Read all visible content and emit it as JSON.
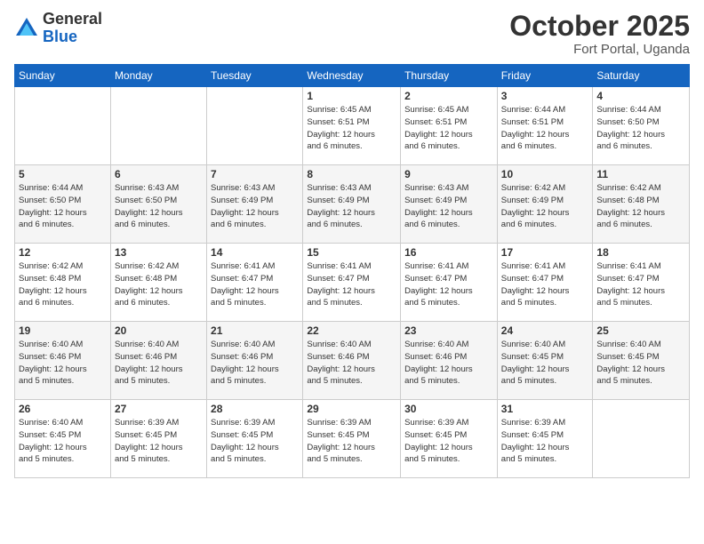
{
  "header": {
    "logo_general": "General",
    "logo_blue": "Blue",
    "month_title": "October 2025",
    "location": "Fort Portal, Uganda"
  },
  "weekdays": [
    "Sunday",
    "Monday",
    "Tuesday",
    "Wednesday",
    "Thursday",
    "Friday",
    "Saturday"
  ],
  "weeks": [
    [
      {
        "day": "",
        "info": ""
      },
      {
        "day": "",
        "info": ""
      },
      {
        "day": "",
        "info": ""
      },
      {
        "day": "1",
        "info": "Sunrise: 6:45 AM\nSunset: 6:51 PM\nDaylight: 12 hours\nand 6 minutes."
      },
      {
        "day": "2",
        "info": "Sunrise: 6:45 AM\nSunset: 6:51 PM\nDaylight: 12 hours\nand 6 minutes."
      },
      {
        "day": "3",
        "info": "Sunrise: 6:44 AM\nSunset: 6:51 PM\nDaylight: 12 hours\nand 6 minutes."
      },
      {
        "day": "4",
        "info": "Sunrise: 6:44 AM\nSunset: 6:50 PM\nDaylight: 12 hours\nand 6 minutes."
      }
    ],
    [
      {
        "day": "5",
        "info": "Sunrise: 6:44 AM\nSunset: 6:50 PM\nDaylight: 12 hours\nand 6 minutes."
      },
      {
        "day": "6",
        "info": "Sunrise: 6:43 AM\nSunset: 6:50 PM\nDaylight: 12 hours\nand 6 minutes."
      },
      {
        "day": "7",
        "info": "Sunrise: 6:43 AM\nSunset: 6:49 PM\nDaylight: 12 hours\nand 6 minutes."
      },
      {
        "day": "8",
        "info": "Sunrise: 6:43 AM\nSunset: 6:49 PM\nDaylight: 12 hours\nand 6 minutes."
      },
      {
        "day": "9",
        "info": "Sunrise: 6:43 AM\nSunset: 6:49 PM\nDaylight: 12 hours\nand 6 minutes."
      },
      {
        "day": "10",
        "info": "Sunrise: 6:42 AM\nSunset: 6:49 PM\nDaylight: 12 hours\nand 6 minutes."
      },
      {
        "day": "11",
        "info": "Sunrise: 6:42 AM\nSunset: 6:48 PM\nDaylight: 12 hours\nand 6 minutes."
      }
    ],
    [
      {
        "day": "12",
        "info": "Sunrise: 6:42 AM\nSunset: 6:48 PM\nDaylight: 12 hours\nand 6 minutes."
      },
      {
        "day": "13",
        "info": "Sunrise: 6:42 AM\nSunset: 6:48 PM\nDaylight: 12 hours\nand 6 minutes."
      },
      {
        "day": "14",
        "info": "Sunrise: 6:41 AM\nSunset: 6:47 PM\nDaylight: 12 hours\nand 5 minutes."
      },
      {
        "day": "15",
        "info": "Sunrise: 6:41 AM\nSunset: 6:47 PM\nDaylight: 12 hours\nand 5 minutes."
      },
      {
        "day": "16",
        "info": "Sunrise: 6:41 AM\nSunset: 6:47 PM\nDaylight: 12 hours\nand 5 minutes."
      },
      {
        "day": "17",
        "info": "Sunrise: 6:41 AM\nSunset: 6:47 PM\nDaylight: 12 hours\nand 5 minutes."
      },
      {
        "day": "18",
        "info": "Sunrise: 6:41 AM\nSunset: 6:47 PM\nDaylight: 12 hours\nand 5 minutes."
      }
    ],
    [
      {
        "day": "19",
        "info": "Sunrise: 6:40 AM\nSunset: 6:46 PM\nDaylight: 12 hours\nand 5 minutes."
      },
      {
        "day": "20",
        "info": "Sunrise: 6:40 AM\nSunset: 6:46 PM\nDaylight: 12 hours\nand 5 minutes."
      },
      {
        "day": "21",
        "info": "Sunrise: 6:40 AM\nSunset: 6:46 PM\nDaylight: 12 hours\nand 5 minutes."
      },
      {
        "day": "22",
        "info": "Sunrise: 6:40 AM\nSunset: 6:46 PM\nDaylight: 12 hours\nand 5 minutes."
      },
      {
        "day": "23",
        "info": "Sunrise: 6:40 AM\nSunset: 6:46 PM\nDaylight: 12 hours\nand 5 minutes."
      },
      {
        "day": "24",
        "info": "Sunrise: 6:40 AM\nSunset: 6:45 PM\nDaylight: 12 hours\nand 5 minutes."
      },
      {
        "day": "25",
        "info": "Sunrise: 6:40 AM\nSunset: 6:45 PM\nDaylight: 12 hours\nand 5 minutes."
      }
    ],
    [
      {
        "day": "26",
        "info": "Sunrise: 6:40 AM\nSunset: 6:45 PM\nDaylight: 12 hours\nand 5 minutes."
      },
      {
        "day": "27",
        "info": "Sunrise: 6:39 AM\nSunset: 6:45 PM\nDaylight: 12 hours\nand 5 minutes."
      },
      {
        "day": "28",
        "info": "Sunrise: 6:39 AM\nSunset: 6:45 PM\nDaylight: 12 hours\nand 5 minutes."
      },
      {
        "day": "29",
        "info": "Sunrise: 6:39 AM\nSunset: 6:45 PM\nDaylight: 12 hours\nand 5 minutes."
      },
      {
        "day": "30",
        "info": "Sunrise: 6:39 AM\nSunset: 6:45 PM\nDaylight: 12 hours\nand 5 minutes."
      },
      {
        "day": "31",
        "info": "Sunrise: 6:39 AM\nSunset: 6:45 PM\nDaylight: 12 hours\nand 5 minutes."
      },
      {
        "day": "",
        "info": ""
      }
    ]
  ]
}
